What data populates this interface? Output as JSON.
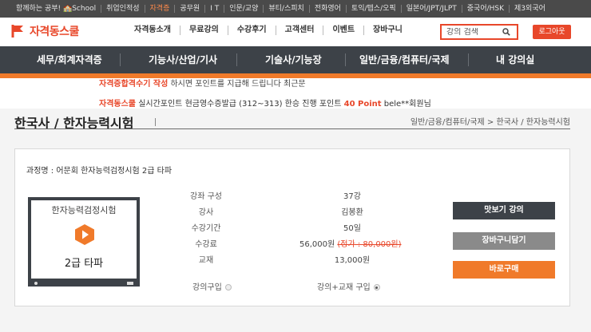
{
  "topbar": {
    "items": [
      "함께하는 공부! 🏫School",
      "취업인적성",
      "자격증",
      "공무원",
      "I T",
      "인문/교양",
      "뷰티/스피치",
      "전화영어",
      "토익/텝스/오픽",
      "일본어/JPT/JLPT",
      "중국어/HSK",
      "제3외국어"
    ]
  },
  "header": {
    "logo_text": "자격동스쿨",
    "gnb": [
      "자격동소개",
      "무료강의",
      "수강후기",
      "고객센터",
      "이벤트",
      "장바구니"
    ],
    "search_placeholder": "강의 검색",
    "logout_label": "로그아웃"
  },
  "mainnav": {
    "items": [
      "세무/회계자격증",
      "기능사/산업/기사",
      "기술사/기능장",
      "일반/금융/컴퓨터/국제",
      "내 강의실"
    ]
  },
  "ticker": {
    "line1_a": "자격증합격수기 작성",
    "line1_b": "하시면 포인트를 지급해 드립니다",
    "line1_c": "최근문",
    "line2_brand": "자격동스쿨",
    "line2_text": "실시간포인트 현금영수증발급 (312~313) 한승 진행 포인트",
    "line2_points": "40 Point",
    "line2_user": "bele**회원님"
  },
  "page": {
    "title": "한국사 / 한자능력시험",
    "breadcrumb": "일반/금융/컴퓨터/국제 > 한국사 / 한자능력시험"
  },
  "course": {
    "name_label": "과정명 : 어문회 한자능력검정시험 2급 타파",
    "thumb_title": "한자능력검정시험",
    "thumb_level": "2급 타파",
    "rows": [
      {
        "label": "강좌 구성",
        "value": "37강"
      },
      {
        "label": "강사",
        "value": "김봉환"
      },
      {
        "label": "수강기간",
        "value": "50일"
      },
      {
        "label": "수강료",
        "value": "56,000원",
        "orig": "(정가 : 80,000원)"
      },
      {
        "label": "교재",
        "value": "13,000원"
      }
    ],
    "option_lecture": "강의구입",
    "option_bundle": "강의+교재 구입",
    "btn_preview": "맛보기 강의",
    "btn_cart": "장바구니담기",
    "btn_buy": "바로구매"
  }
}
